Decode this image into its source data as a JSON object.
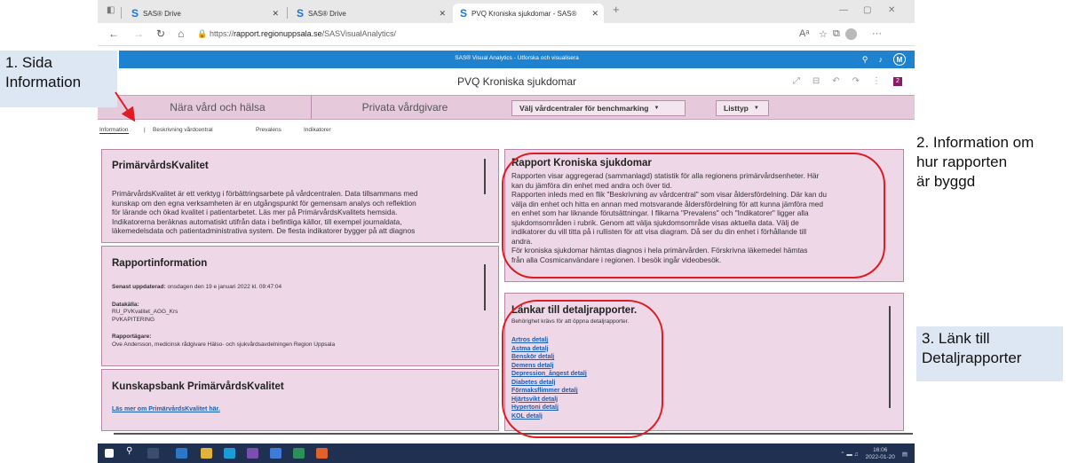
{
  "browser": {
    "tabs": [
      {
        "label": "SAS® Drive"
      },
      {
        "label": "SAS® Drive"
      },
      {
        "label": "PVQ Kroniska sjukdomar - SAS®"
      }
    ],
    "url_prefix": "https://",
    "url_host": "rapport.regionuppsala.se",
    "url_path": "/SASVisualAnalytics/"
  },
  "sas": {
    "app_title": "SAS® Visual Analytics - Utforska och visualisera",
    "user_initial": "M",
    "report_title": "PVQ Kroniska sjukdomar",
    "page_badge": "2",
    "segments": [
      "Nära vård och hälsa",
      "Privata vårdgivare"
    ],
    "dropdown_benchmark": "Välj vårdcentraler för benchmarking",
    "dropdown_listtyp": "Listtyp",
    "nav_tabs": [
      "Information",
      "Beskrivning vårdcentral",
      "Prevalens",
      "Indikatorer"
    ],
    "nav_sep": "|"
  },
  "panels": {
    "pk": {
      "title": "PrimärvårdsKvalitet",
      "lines": [
        "PrimärvårdsKvalitet är ett verktyg i förbättringsarbete på vårdcentralen. Data tillsammans med",
        "kunskap om den egna verksamheten är en utgångspunkt för gemensam analys och reflektion",
        "för lärande och ökad kvalitet i patientarbetet. Läs mer på PrimärvårdsKvalitets hemsida.",
        "Indikatorerna beräknas automatiskt utifrån data i befintliga källor, till exempel journaldata,",
        "läkemedelsdata och patientadministrativa system. De flesta indikatorer bygger på att diagnos"
      ]
    },
    "ri": {
      "title": "Rapportinformation",
      "updated_label": "Senast uppdaterad:",
      "updated_value": "onsdagen den 19 e januari 2022 kl. 09:47:04",
      "source_label": "Datakälla:",
      "source_lines": [
        "RU_PVKvalitet_AGG_Krs",
        "PVKAPITERING"
      ],
      "owner_label": "Rapportägare:",
      "owner_value": "Ove Andersson, medicinsk rådgivare Hälso- och sjukvårdsavdelningen Region Uppsala"
    },
    "kb": {
      "title": "Kunskapsbank PrimärvårdsKvalitet",
      "link": "Läs mer om PrimärvårdsKvalitet här."
    },
    "rk": {
      "title": "Rapport Kroniska sjukdomar",
      "lines": [
        "Rapporten visar aggregerad (sammanlagd) statistik för alla regionens primärvårdsenheter. Här",
        "kan du jämföra din enhet med andra och över tid.",
        "Rapporten inleds med en flik \"Beskrivning av vårdcentral\" som visar åldersfördelning. Där kan du",
        "välja din enhet och hitta en annan med motsvarande åldersfördelning för att kunna jämföra med",
        "en enhet som har liknande förutsättningar. I flikarna \"Prevalens\" och \"Indikatorer\" ligger alla",
        "sjukdomsområden i rubrik. Genom att välja sjukdomsområde visas aktuella data. Välj de",
        "indikatorer du vill titta på i rullisten för att visa diagram. Då ser du din enhet i förhållande till",
        "andra.",
        "För kroniska sjukdomar hämtas diagnos i hela primärvården. Förskrivna läkemedel hämtas",
        "från alla Cosmicanvändare i regionen. I besök ingår videobesök."
      ]
    },
    "lk": {
      "title": "Länkar till detaljrapporter.",
      "subtitle": "Behörighet krävs för att öppna detaljrapporter.",
      "links": [
        "Artros detalj",
        "Astma detalj",
        "Benskör detalj",
        "Demens detalj",
        "Depression_ångest detalj",
        "Diabetes detalj",
        "Förmaksflimmer detalj",
        "Hjärtsvikt detalj",
        "Hypertoni detalj",
        "KOL detalj"
      ]
    }
  },
  "annotations": {
    "a1": [
      "1. Sida",
      "Information"
    ],
    "a2": [
      "2. Information om",
      "hur rapporten",
      "är byggd"
    ],
    "a3": [
      "3. Länk till",
      "Detaljrapporter"
    ]
  },
  "taskbar": {
    "time": "16:06",
    "date": "2022-01-20"
  },
  "colors": {
    "sas_blue": "#1f82cf",
    "panel_pink": "#eed7e6",
    "bar_pink": "#e7c9dc",
    "annotation_red": "#e01b24",
    "callout_blue": "#dde6f3"
  }
}
